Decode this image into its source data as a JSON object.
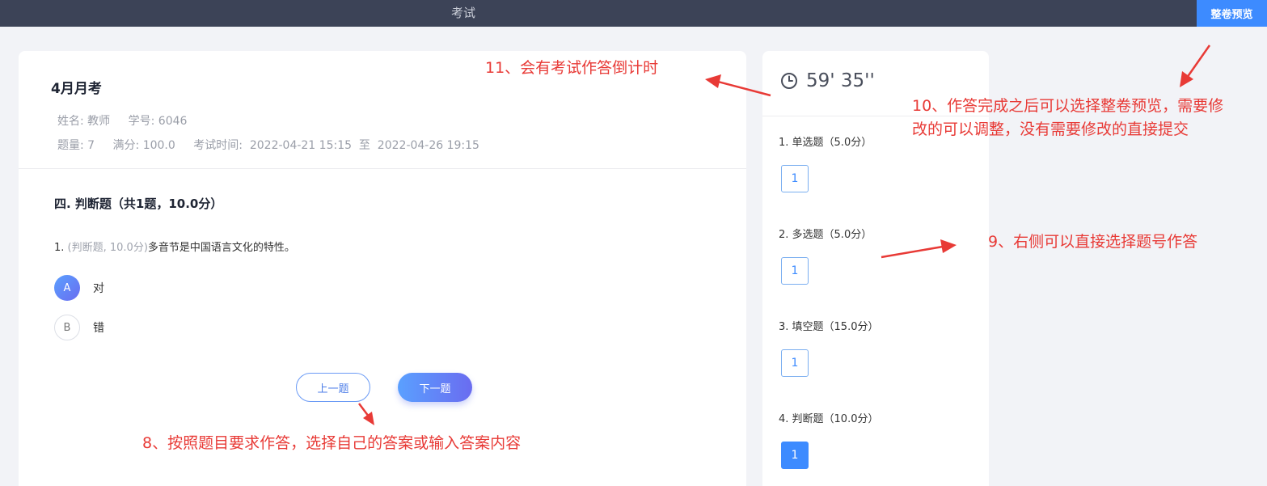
{
  "topbar": {
    "title": "考试",
    "preview_button": "整卷预览"
  },
  "exam": {
    "title": "4月月考",
    "name_label": "姓名: 教师",
    "student_id_label": "学号: 6046",
    "count_label": "题量: 7",
    "score_label": "满分: 100.0",
    "time_label": "考试时间:  2022-04-21 15:15  至  2022-04-26 19:15"
  },
  "section": {
    "title": "四. 判断题（共1题，10.0分）"
  },
  "question": {
    "number": "1. ",
    "meta": "(判断题, 10.0分)",
    "text": "多音节是中国语言文化的特性。",
    "options": [
      {
        "letter": "A",
        "text": "对",
        "selected": true
      },
      {
        "letter": "B",
        "text": "错",
        "selected": false
      }
    ]
  },
  "nav": {
    "prev_label": "上一题",
    "next_label": "下一题"
  },
  "timer": {
    "value": "59' 35''",
    "icon": "clock-icon"
  },
  "side_groups": [
    {
      "title": "1. 单选题（5.0分）",
      "items": [
        "1"
      ],
      "active": false
    },
    {
      "title": "2. 多选题（5.0分）",
      "items": [
        "1"
      ],
      "active": false
    },
    {
      "title": "3. 填空题（15.0分）",
      "items": [
        "1"
      ],
      "active": false
    },
    {
      "title": "4. 判断题（10.0分）",
      "items": [
        "1"
      ],
      "active": true
    }
  ],
  "annotations": {
    "a8": "8、按照题目要求作答，选择自己的答案或输入答案内容",
    "a9": "9、右侧可以直接选择题号作答",
    "a10_line1": "10、作答完成之后可以选择整卷预览，需要修",
    "a10_line2": "改的可以调整，没有需要修改的直接提交",
    "a11": "11、会有考试作答倒计时"
  },
  "colors": {
    "accent": "#3d8bff",
    "annotation": "#e83a36",
    "topbar": "#3c4357"
  }
}
